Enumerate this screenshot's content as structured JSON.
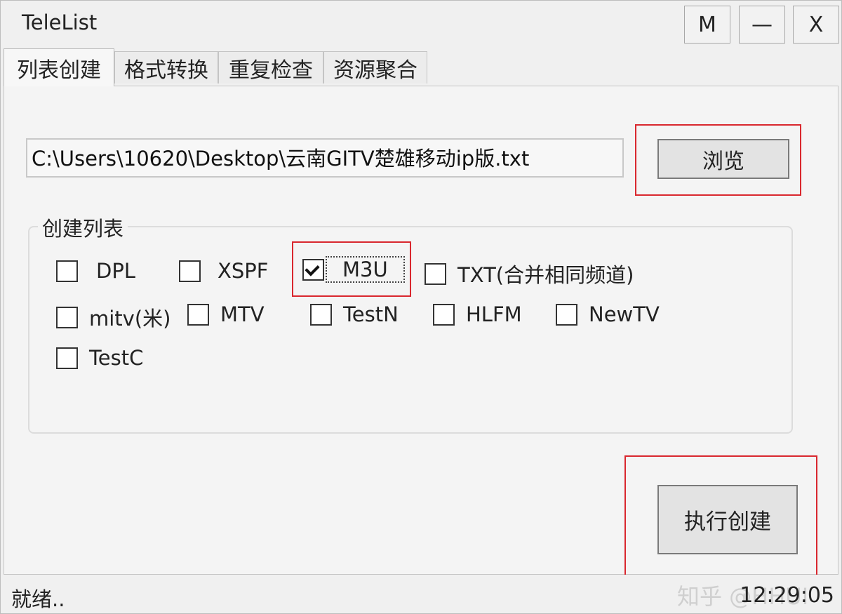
{
  "window": {
    "title": "TeleList"
  },
  "controls": {
    "maximize": "M",
    "minimize": "—",
    "close": "X"
  },
  "tabs": [
    "列表创建",
    "格式转换",
    "重复检查",
    "资源聚合"
  ],
  "path": {
    "value": "C:\\Users\\10620\\Desktop\\云南GITV楚雄移动ip版.txt"
  },
  "browse_label": "浏览",
  "group": {
    "label": "创建列表",
    "options": [
      {
        "label": "DPL",
        "checked": false
      },
      {
        "label": "XSPF",
        "checked": false
      },
      {
        "label": "M3U",
        "checked": true
      },
      {
        "label": "TXT(合并相同频道)",
        "checked": false
      },
      {
        "label": "mitv(米)",
        "checked": false
      },
      {
        "label": "MTV",
        "checked": false
      },
      {
        "label": "TestN",
        "checked": false
      },
      {
        "label": "HLFM",
        "checked": false
      },
      {
        "label": "NewTV",
        "checked": false
      },
      {
        "label": "TestC",
        "checked": false
      }
    ]
  },
  "execute_label": "执行创建",
  "status": {
    "text": "就绪..",
    "time": "12:29:05",
    "watermark": "知乎 @HHUI"
  },
  "colors": {
    "highlight": "#d9272e"
  }
}
